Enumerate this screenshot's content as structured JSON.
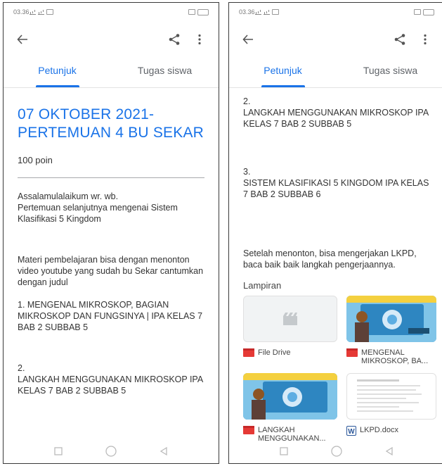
{
  "left": {
    "status_time": "03.36",
    "tabs": [
      "Petunjuk",
      "Tugas siswa"
    ],
    "title": "07 OKTOBER 2021-PERTEMUAN 4 BU SEKAR",
    "points": "100 poin",
    "paragraphs": [
      "Assalamulalaikum wr. wb.\nPertemuan selanjutnya mengenai Sistem Klasifikasi 5 Kingdom",
      "Materi pembelajaran bisa dengan menonton video youtube yang sudah bu Sekar cantumkan dengan judul",
      "1. MENGENAL MIKROSKOP, BAGIAN MIKROSKOP DAN FUNGSINYA | IPA KELAS 7 BAB 2 SUBBAB 5",
      "2.\nLANGKAH MENGGUNAKAN MIKROSKOP IPA KELAS 7 BAB 2 SUBBAB 5"
    ]
  },
  "right": {
    "status_time": "03.36",
    "tabs": [
      "Petunjuk",
      "Tugas siswa"
    ],
    "paragraphs": [
      "2.\nLANGKAH MENGGUNAKAN MIKROSKOP IPA KELAS 7 BAB 2 SUBBAB 5",
      "3.\nSISTEM KLASIFIKASI 5 KINGDOM IPA KELAS 7 BAB 2 SUBBAB 6",
      "Setelah menonton, bisa mengerjakan LKPD, baca baik baik langkah pengerjaannya."
    ],
    "lampiran_label": "Lampiran",
    "attachments": [
      {
        "label": "File Drive"
      },
      {
        "label": "MENGENAL MIKROSKOP, BA..."
      },
      {
        "label": "LANGKAH MENGGUNAKAN..."
      },
      {
        "label": "LKPD.docx"
      }
    ]
  },
  "colors": {
    "accent": "#1a73e8",
    "drive_red": "#e53935",
    "word_blue": "#2b579a"
  }
}
